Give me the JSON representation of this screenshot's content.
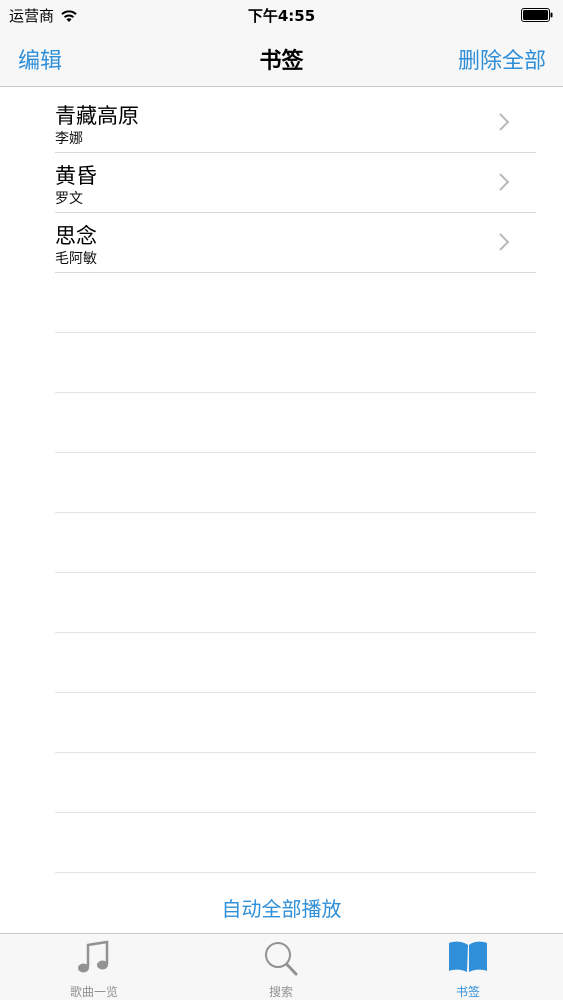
{
  "status_bar": {
    "carrier": "运营商",
    "time": "下午4:55"
  },
  "nav": {
    "left_button": "编辑",
    "title": "书签",
    "right_button": "删除全部"
  },
  "bookmarks": [
    {
      "title": "青藏高原",
      "artist": "李娜"
    },
    {
      "title": "黄昏",
      "artist": "罗文"
    },
    {
      "title": "思念",
      "artist": "毛阿敏"
    }
  ],
  "play_all_label": "自动全部播放",
  "tabs": [
    {
      "label": "歌曲一览",
      "icon": "music-note-icon",
      "active": false
    },
    {
      "label": "搜索",
      "icon": "search-icon",
      "active": false
    },
    {
      "label": "书签",
      "icon": "book-icon",
      "active": true
    }
  ],
  "colors": {
    "accent": "#2f8fd8",
    "inactive_tab": "#929292",
    "bar_background": "#f7f7f7"
  }
}
